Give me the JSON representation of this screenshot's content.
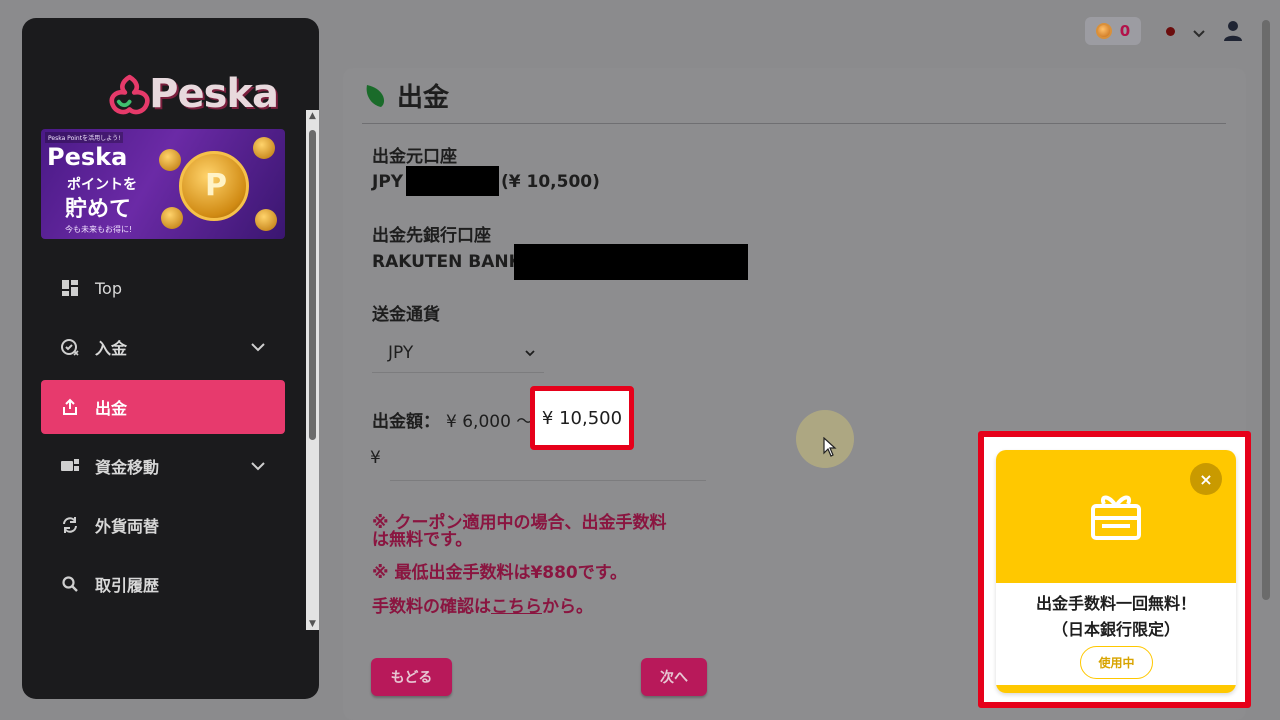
{
  "brand": {
    "name": "Peska"
  },
  "banner": {
    "tag": "Peska Pointを活用しよう!",
    "line1": "Peska",
    "line2": "ポイントを",
    "line3": "貯めて",
    "line4": "今も未来もお得に!",
    "coin_letter": "P"
  },
  "sidebar": {
    "items": [
      {
        "label": "Top",
        "icon": "dashboard-icon",
        "expandable": false,
        "active": false
      },
      {
        "label": "入金",
        "icon": "deposit-icon",
        "expandable": true,
        "active": false
      },
      {
        "label": "出金",
        "icon": "withdraw-icon",
        "expandable": false,
        "active": true
      },
      {
        "label": "資金移動",
        "icon": "transfer-icon",
        "expandable": true,
        "active": false
      },
      {
        "label": "外貨両替",
        "icon": "exchange-icon",
        "expandable": false,
        "active": false
      },
      {
        "label": "取引履歴",
        "icon": "search-icon",
        "expandable": false,
        "active": false
      }
    ]
  },
  "header": {
    "points": "0",
    "language_icon": "language-dot-icon",
    "user_icon": "user-icon"
  },
  "page": {
    "title": "出金",
    "source_account_label": "出金元口座",
    "source_account_currency": "JPY",
    "source_account_balance": "(¥ 10,500)",
    "dest_account_label": "出金先銀行口座",
    "dest_account_bank": "RAKUTEN BANK,",
    "currency_label": "送金通貨",
    "currency_value": "JPY",
    "amount_label": "出金額：",
    "amount_range": "¥ 6,000 〜",
    "amount_max": "¥ 10,500",
    "amount_prefix": "¥",
    "note1_line1": "※ クーポン適用中の場合、出金手数料",
    "note1_line2": "は無料です。",
    "note2": "※ 最低出金手数料は¥880です。",
    "note3_before": "手数料の確認は",
    "note3_link": "こちら",
    "note3_after": "から。",
    "back_button": "もどる",
    "next_button": "次へ"
  },
  "coupon": {
    "close": "×",
    "title_line1": "出金手数料一回無料！",
    "title_line2": "（日本銀行限定）",
    "status_button": "使用中"
  },
  "colors": {
    "accent": "#e73a6d",
    "button": "#b8195a",
    "note": "#8a1540",
    "coupon": "#ffc800",
    "highlight": "#e6001a"
  }
}
